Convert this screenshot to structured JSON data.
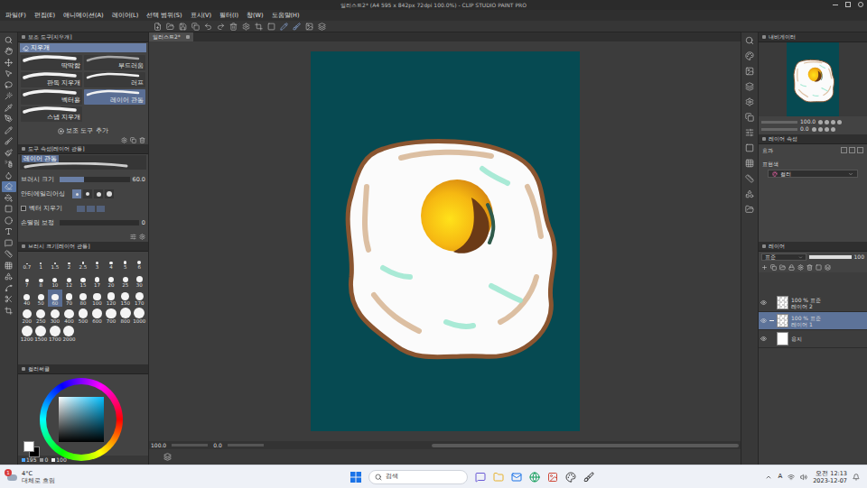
{
  "window": {
    "title": "일러스트2* (A4 595 x 842px 72dpi 100.0%) - CLIP STUDIO PAINT PRO"
  },
  "menu": [
    "파일(F)",
    "편집(E)",
    "애니메이션(A)",
    "레이어(L)",
    "선택 범위(S)",
    "표시(V)",
    "필터(I)",
    "창(W)",
    "도움말(H)"
  ],
  "tools": [
    {
      "selected": false
    },
    {
      "selected": false
    },
    {
      "selected": false
    },
    {
      "selected": false
    },
    {
      "selected": false
    },
    {
      "selected": false
    },
    {
      "selected": false
    },
    {
      "selected": false
    },
    {
      "selected": false
    },
    {
      "selected": false
    },
    {
      "selected": false
    },
    {
      "selected": false
    },
    {
      "selected": false
    },
    {
      "selected": true
    },
    {
      "selected": false
    },
    {
      "selected": false
    },
    {
      "selected": false
    },
    {
      "selected": false
    },
    {
      "selected": false
    },
    {
      "selected": false
    },
    {
      "selected": false
    },
    {
      "selected": false
    },
    {
      "selected": false
    },
    {
      "selected": false
    },
    {
      "selected": false
    }
  ],
  "sub_tool": {
    "title": "보조 도구[지우개]",
    "group": "지우개",
    "items": [
      {
        "label": "딱딱함",
        "selected": false
      },
      {
        "label": "부드러움",
        "selected": false
      },
      {
        "label": "판독 지우개",
        "selected": false
      },
      {
        "label": "러프",
        "selected": false
      },
      {
        "label": "벡터용",
        "selected": false
      },
      {
        "label": "레이어 관통",
        "selected": true
      },
      {
        "label": "스냅 지우개",
        "selected": false
      }
    ],
    "add": "보조 도구 추가"
  },
  "tool_property": {
    "title": "도구 속성[레이어 관통]",
    "preset": "레이어 관통",
    "brush_size": {
      "label": "브러시 크기",
      "value": "60.0",
      "level": 0.35
    },
    "antialiasing": {
      "label": "안티에일리어싱",
      "options": [
        {
          "selected": true
        },
        {
          "selected": false
        },
        {
          "selected": false
        },
        {
          "selected": false
        }
      ]
    },
    "vector_erase": {
      "label": "벡터 지우기",
      "checked": false
    },
    "stabilization": {
      "label": "손떨림 보정",
      "value": "0",
      "level": 0
    }
  },
  "brush_size_panel": {
    "title": "브러시 크기[레이어 관통]",
    "sizes": [
      {
        "label": "0.7",
        "selected": false
      },
      {
        "label": "1",
        "selected": false
      },
      {
        "label": "1.5",
        "selected": false
      },
      {
        "label": "2",
        "selected": false
      },
      {
        "label": "2.5",
        "selected": false
      },
      {
        "label": "3",
        "selected": false
      },
      {
        "label": "4",
        "selected": false
      },
      {
        "label": "5",
        "selected": false
      },
      {
        "label": "6",
        "selected": false
      },
      {
        "label": "7",
        "selected": false
      },
      {
        "label": "8",
        "selected": false
      },
      {
        "label": "10",
        "selected": false
      },
      {
        "label": "12",
        "selected": false
      },
      {
        "label": "15",
        "selected": false
      },
      {
        "label": "17",
        "selected": false
      },
      {
        "label": "20",
        "selected": false
      },
      {
        "label": "25",
        "selected": false
      },
      {
        "label": "30",
        "selected": false
      },
      {
        "label": "40",
        "selected": false
      },
      {
        "label": "50",
        "selected": false
      },
      {
        "label": "60",
        "selected": true
      },
      {
        "label": "70",
        "selected": false
      },
      {
        "label": "80",
        "selected": false
      },
      {
        "label": "100",
        "selected": false
      },
      {
        "label": "120",
        "selected": false
      },
      {
        "label": "150",
        "selected": false
      },
      {
        "label": "170",
        "selected": false
      },
      {
        "label": "200",
        "selected": false
      },
      {
        "label": "250",
        "selected": false
      },
      {
        "label": "300",
        "selected": false
      },
      {
        "label": "400",
        "selected": false
      },
      {
        "label": "500",
        "selected": false
      },
      {
        "label": "600",
        "selected": false
      },
      {
        "label": "700",
        "selected": false
      },
      {
        "label": "800",
        "selected": false
      },
      {
        "label": "1000",
        "selected": false
      },
      {
        "label": "1200",
        "selected": false
      },
      {
        "label": "1500",
        "selected": false
      },
      {
        "label": "1700",
        "selected": false
      },
      {
        "label": "2000",
        "selected": false
      }
    ]
  },
  "color_panel": {
    "title": "컬러써클",
    "values": [
      "195",
      "0",
      "100"
    ]
  },
  "canvas": {
    "tab": "일러스트2*",
    "zoom": "100.0",
    "rotation": "0.0"
  },
  "navigator": {
    "title": "내비게이터",
    "zoom": "100.0",
    "rotation": "0.0"
  },
  "layer_property": {
    "title": "레이어 속성",
    "effect": "효과",
    "color_label": "표현색",
    "color_mode": "컬러"
  },
  "layers_panel": {
    "title": "레이어",
    "blend": "표준",
    "opacity": "100",
    "layers": [
      {
        "blend": "100 % 표준",
        "name": "레이어 2",
        "kind": "raster",
        "visible": true,
        "selected": false
      },
      {
        "blend": "100 % 표준",
        "name": "레이어 1",
        "kind": "raster",
        "visible": true,
        "selected": true
      },
      {
        "name": "용지",
        "kind": "paper",
        "visible": true,
        "selected": false
      }
    ]
  },
  "taskbar": {
    "weather": {
      "temp": "4°C",
      "desc": "대체로 흐림",
      "badge": "1"
    },
    "search": "검색",
    "ime": "A",
    "time": "오전 12:13",
    "date": "2023-12-07"
  }
}
